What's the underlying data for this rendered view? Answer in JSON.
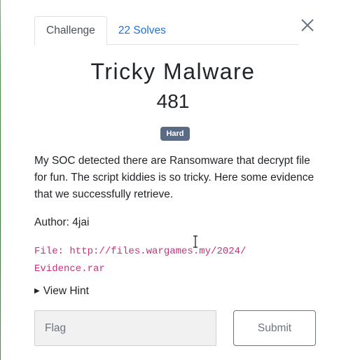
{
  "tabs": [
    {
      "label": "Challenge",
      "active": true
    },
    {
      "label": "22 Solves",
      "active": false
    }
  ],
  "challenge": {
    "name": "Tricky Malware",
    "points": "481",
    "difficulty": "Hard",
    "description": "My SOC detected there are Ransomware that decrypt file for fun. The script kiddies is so tricky. Here some evidence that we successfully retrieve.",
    "author": "Author: 4jai",
    "file_line1": "File: http://files.wargames.my/2024/",
    "file_line2": "Evidence.rar",
    "hint_label": "View Hint"
  },
  "form": {
    "flag_placeholder": "Flag",
    "submit_label": "Submit"
  },
  "colors": {
    "link": "#1a73e8",
    "badge": "#5a6b85",
    "code": "#c7307a"
  },
  "icons": {
    "close": "close-icon",
    "hint_arrow": "triangle-right-icon",
    "cursor": "text-cursor-icon"
  }
}
